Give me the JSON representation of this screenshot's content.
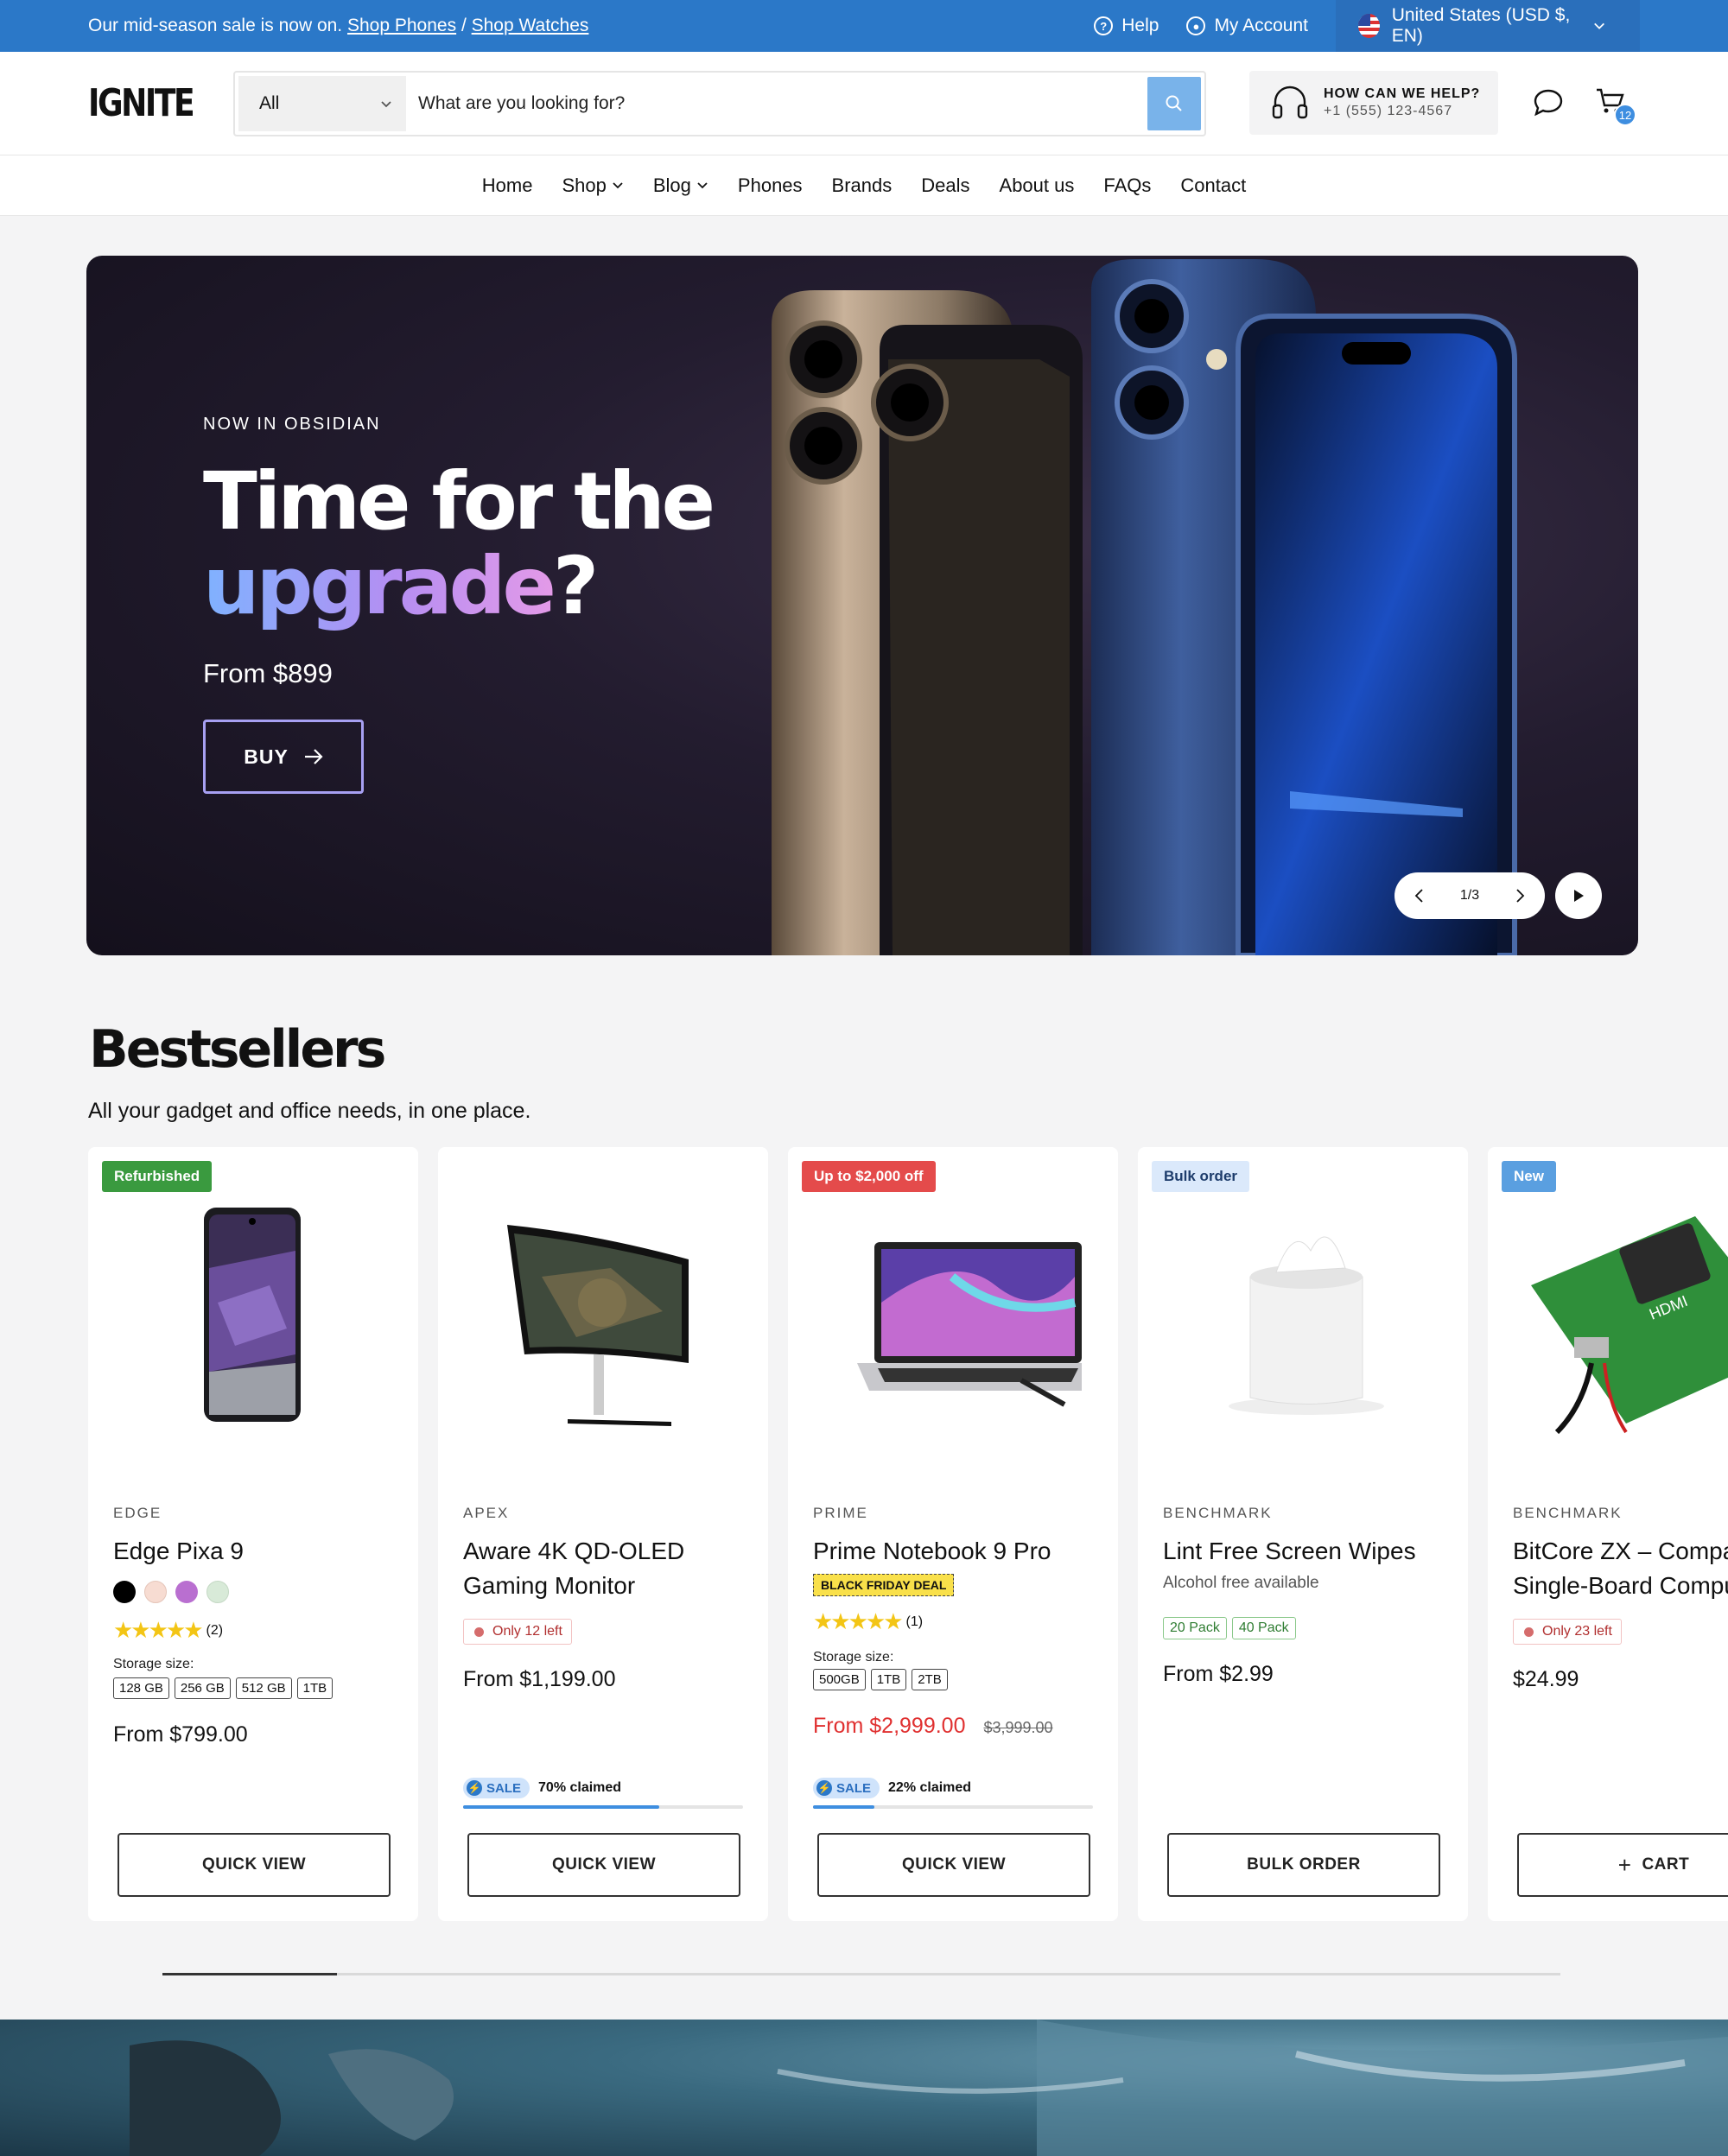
{
  "announcement": {
    "message": "Our mid-season sale is now on.",
    "link1": "Shop Phones",
    "separator": "/",
    "link2": "Shop Watches",
    "help": "Help",
    "account": "My Account",
    "region": "United States (USD $, EN)"
  },
  "header": {
    "logo": "IGNITE",
    "category": "All",
    "search_placeholder": "What are you looking for?",
    "help_title": "HOW CAN WE HELP?",
    "help_phone": "+1 (555) 123-4567",
    "cart_count": "12"
  },
  "nav": [
    "Home",
    "Shop",
    "Blog",
    "Phones",
    "Brands",
    "Deals",
    "About us",
    "FAQs",
    "Contact"
  ],
  "hero": {
    "eyebrow": "NOW IN OBSIDIAN",
    "title_line1": "Time for the",
    "title_grad": "upgrade",
    "title_end": "?",
    "price": "From $899",
    "cta": "BUY",
    "slide": "1/3"
  },
  "bestsellers": {
    "title": "Bestsellers",
    "subtitle": "All your gadget and office needs, in one place."
  },
  "products": [
    {
      "badge": "Refurbished",
      "badge_color": "#3a9a3f",
      "brand": "EDGE",
      "name": "Edge Pixa 9",
      "colors": [
        "#000000",
        "#f7dcd2",
        "#b96fd0",
        "#d8ead8"
      ],
      "rating_count": "(2)",
      "storage_label": "Storage size:",
      "storage": [
        "128 GB",
        "256 GB",
        "512 GB",
        "1TB"
      ],
      "price": "From $799.00",
      "button": "QUICK VIEW"
    },
    {
      "brand": "APEX",
      "name": "Aware 4K QD-OLED Gaming Monitor",
      "stock": "Only 12 left",
      "price": "From $1,199.00",
      "sale": "SALE",
      "claimed": "70% claimed",
      "claimed_pct": 70,
      "button": "QUICK VIEW"
    },
    {
      "badge": "Up to $2,000 off",
      "badge_color": "#e44b4b",
      "brand": "PRIME",
      "name": "Prime Notebook 9 Pro",
      "deal": "BLACK FRIDAY DEAL",
      "rating_count": "(1)",
      "storage_label": "Storage size:",
      "storage": [
        "500GB",
        "1TB",
        "2TB"
      ],
      "price": "From $2,999.00",
      "compare_price": "$3,999.00",
      "sale": "SALE",
      "claimed": "22% claimed",
      "claimed_pct": 22,
      "button": "QUICK VIEW"
    },
    {
      "badge": "Bulk order",
      "badge_color": "#dbe9fb",
      "brand": "BENCHMARK",
      "name": "Lint Free Screen Wipes",
      "note": "Alcohol free available",
      "packs": [
        "20 Pack",
        "40 Pack"
      ],
      "price": "From $2.99",
      "button": "BULK ORDER"
    },
    {
      "badge": "New",
      "badge_color": "#5a9fe0",
      "brand": "BENCHMARK",
      "name": "BitCore ZX – Compact Single-Board Computer",
      "stock": "Only 23 left",
      "price": "$24.99",
      "button": "CART"
    }
  ]
}
